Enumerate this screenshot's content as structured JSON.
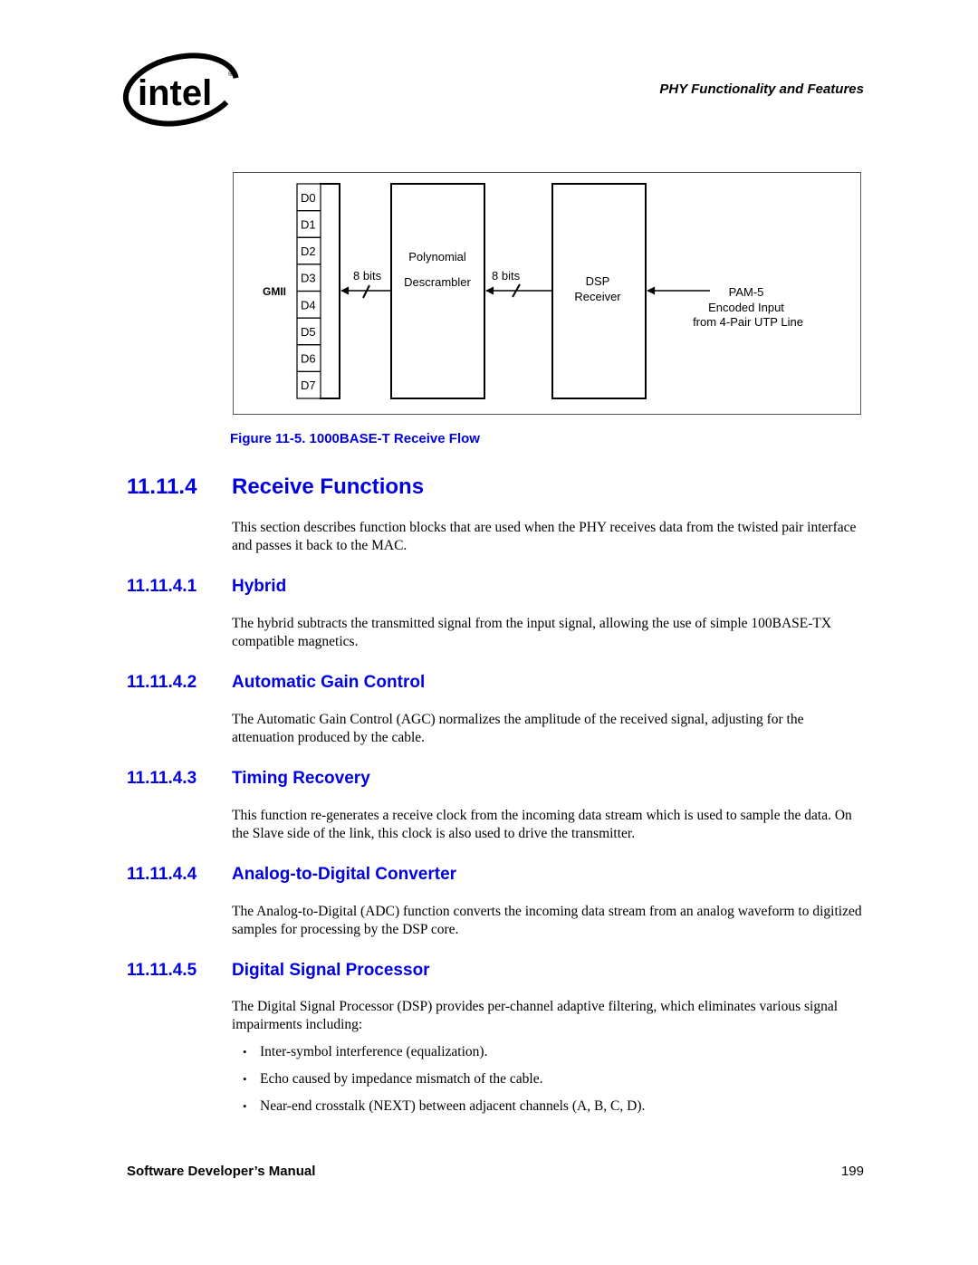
{
  "header": {
    "logo_text": "intel",
    "running_title": "PHY Functionality and Features"
  },
  "figure": {
    "caption": "Figure 11-5. 1000BASE-T Receive Flow",
    "gmii_label": "GMII",
    "data_lines": [
      "D0",
      "D1",
      "D2",
      "D3",
      "D4",
      "D5",
      "D6",
      "D7"
    ],
    "descrambler_label_1": "Polynomial",
    "descrambler_label_2": "Descrambler",
    "bus_width_left": "8 bits",
    "bus_width_right": "8 bits",
    "dsp_label_1": "DSP",
    "dsp_label_2": "Receiver",
    "input_label_1": "PAM-5",
    "input_label_2": "Encoded Input",
    "input_label_3": "from 4-Pair UTP Line"
  },
  "section": {
    "number": "11.11.4",
    "title": "Receive Functions",
    "intro": "This section describes function blocks that are used when the PHY receives data from the twisted pair interface and passes it back to the MAC."
  },
  "subsections": [
    {
      "number": "11.11.4.1",
      "title": "Hybrid",
      "body": "The hybrid subtracts the transmitted signal from the input signal, allowing the use of simple 100BASE-TX compatible magnetics."
    },
    {
      "number": "11.11.4.2",
      "title": "Automatic Gain Control",
      "body": "The Automatic Gain Control (AGC) normalizes the amplitude of the received signal, adjusting for the attenuation produced by the cable."
    },
    {
      "number": "11.11.4.3",
      "title": "Timing Recovery",
      "body": "This function re-generates a receive clock from the incoming data stream which is used to sample the data. On the Slave side of the link, this clock is also used to drive the transmitter."
    },
    {
      "number": "11.11.4.4",
      "title": "Analog-to-Digital Converter",
      "body": "The Analog-to-Digital (ADC) function converts the incoming data stream from an analog waveform to digitized samples for processing by the DSP core."
    },
    {
      "number": "11.11.4.5",
      "title": "Digital Signal Processor",
      "body": "The Digital Signal Processor (DSP) provides per-channel adaptive filtering, which eliminates various signal impairments including:",
      "bullets": [
        "Inter-symbol interference (equalization).",
        "Echo caused by impedance mismatch of the cable.",
        "Near-end crosstalk (NEXT) between adjacent channels (A, B, C, D)."
      ]
    }
  ],
  "footer": {
    "manual_title": "Software Developer’s Manual",
    "page_number": "199"
  },
  "colors": {
    "heading_blue": "#0000e0"
  }
}
